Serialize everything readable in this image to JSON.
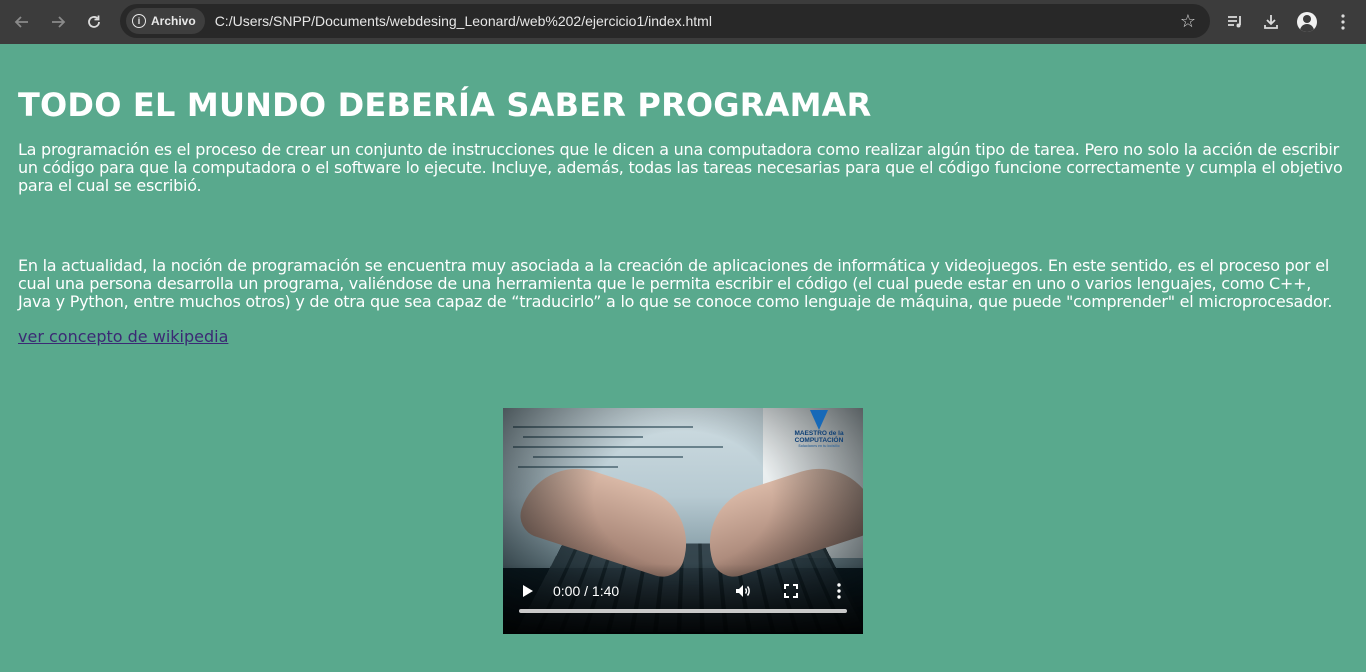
{
  "browser": {
    "site_chip_label": "Archivo",
    "url": "C:/Users/SNPP/Documents/webdesing_Leonard/web%202/ejercicio1/index.html",
    "icons": [
      "back-arrow-icon",
      "forward-arrow-icon",
      "reload-icon",
      "info-icon",
      "star-icon",
      "media-queue-icon",
      "download-icon",
      "profile-icon",
      "kebab-menu-icon"
    ]
  },
  "page": {
    "heading": "TODO EL MUNDO DEBERÍA SABER PROGRAMAR",
    "paragraph1": "La programación es el proceso de crear un conjunto de instrucciones que le dicen a una computadora como realizar algún tipo de tarea. Pero no solo la acción de escribir un código para que la computadora o el software lo ejecute. Incluye, además, todas las tareas necesarias para que el código funcione correctamente y cumpla el objetivo para el cual se escribió.",
    "paragraph2": "En la actualidad, la noción de programación se encuentra muy asociada a la creación de aplicaciones de informática y videojuegos. En este sentido, es el proceso por el cual una persona desarrolla un programa, valiéndose de una herramienta que le permita escribir el código (el cual puede estar en uno o varios lenguajes, como C++, Java y Python, entre muchos otros) y de otra que sea capaz de “traducirlo” a lo que se conoce como lenguaje de máquina, que puede \"comprender\" el microprocesador.",
    "link_text": "ver concepto de wikipedia"
  },
  "video": {
    "time_display": "0:00 / 1:40",
    "progress": 0,
    "logo_line1": "MAESTRO de la",
    "logo_line2": "COMPUTACIÓN",
    "logo_sub": "Soluciones en tu bolsillo"
  },
  "colors": {
    "page_background": "#59a98d",
    "link": "#3b2a74",
    "chrome": "#3c3c3c"
  }
}
